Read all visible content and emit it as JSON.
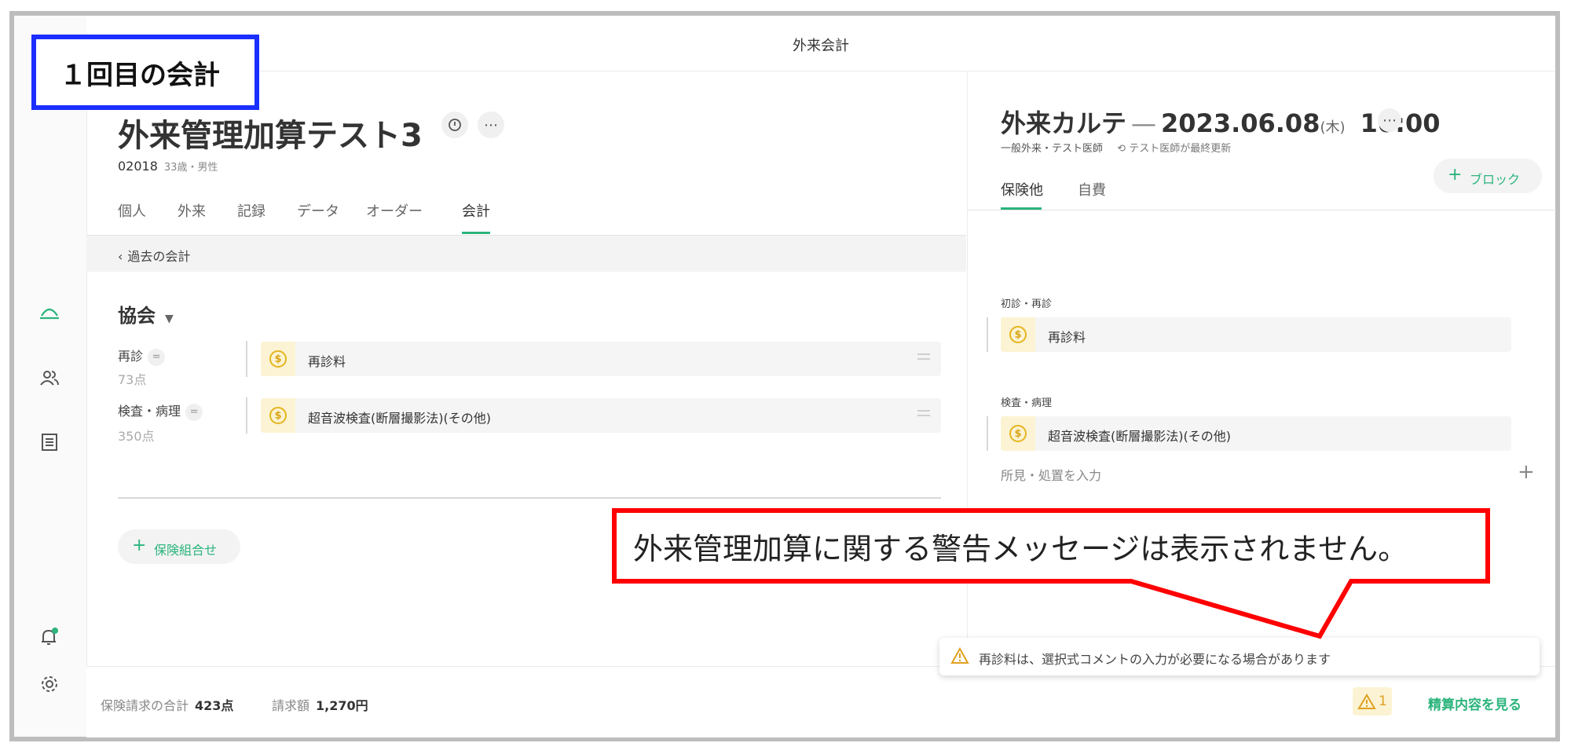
{
  "annotation": {
    "label": "１回目の会計",
    "callout": "外来管理加算に関する警告メッセージは表示されません。"
  },
  "topbar": {
    "title": "外来会計"
  },
  "sidebar": {
    "items": [
      {
        "icon": "reception-bell-icon"
      },
      {
        "icon": "users-icon"
      },
      {
        "icon": "list-document-icon"
      },
      {
        "icon": "notification-bell-icon"
      },
      {
        "icon": "gear-icon"
      }
    ]
  },
  "patient": {
    "name": "外来管理加算テスト3",
    "id": "02018",
    "age_sex": "33歳・男性"
  },
  "tabs": [
    "個人",
    "外来",
    "記録",
    "データ",
    "オーダー",
    "会計"
  ],
  "active_tab": "会計",
  "past_link": "過去の会計",
  "association": "協会",
  "rows": [
    {
      "label": "再診",
      "points": "73点",
      "item": "再診料"
    },
    {
      "label": "検査・病理",
      "points": "350点",
      "item": "超音波検査(断層撮影法)(その他)"
    }
  ],
  "insurance_button": "保険組合せ",
  "karte": {
    "title": "外来カルテ",
    "date": "2023.06.08",
    "weekday": "(木)",
    "time": "10:00",
    "meta_type": "一般外来・テスト医師",
    "meta_updated": "テスト医師が最終更新",
    "block_button": "ブロック",
    "tabs": [
      "保険他",
      "自費"
    ],
    "sections": [
      {
        "title": "初診・再診",
        "item": "再診料"
      },
      {
        "title": "検査・病理",
        "item": "超音波検査(断層撮影法)(その他)"
      }
    ],
    "findings_placeholder": "所見・処置を入力"
  },
  "toast": {
    "message": "再診料は、選択式コメントの入力が必要になる場合があります"
  },
  "footer": {
    "claim_label": "保険請求の合計",
    "claim_value": "423点",
    "bill_label": "請求額",
    "bill_value": "1,270円",
    "warning_count": "1",
    "settle_link": "精算内容を見る"
  },
  "colors": {
    "accent": "#2bb47c",
    "annotation_blue": "#1a2eff",
    "annotation_red": "#ff0000",
    "coin": "#e5b51f"
  }
}
